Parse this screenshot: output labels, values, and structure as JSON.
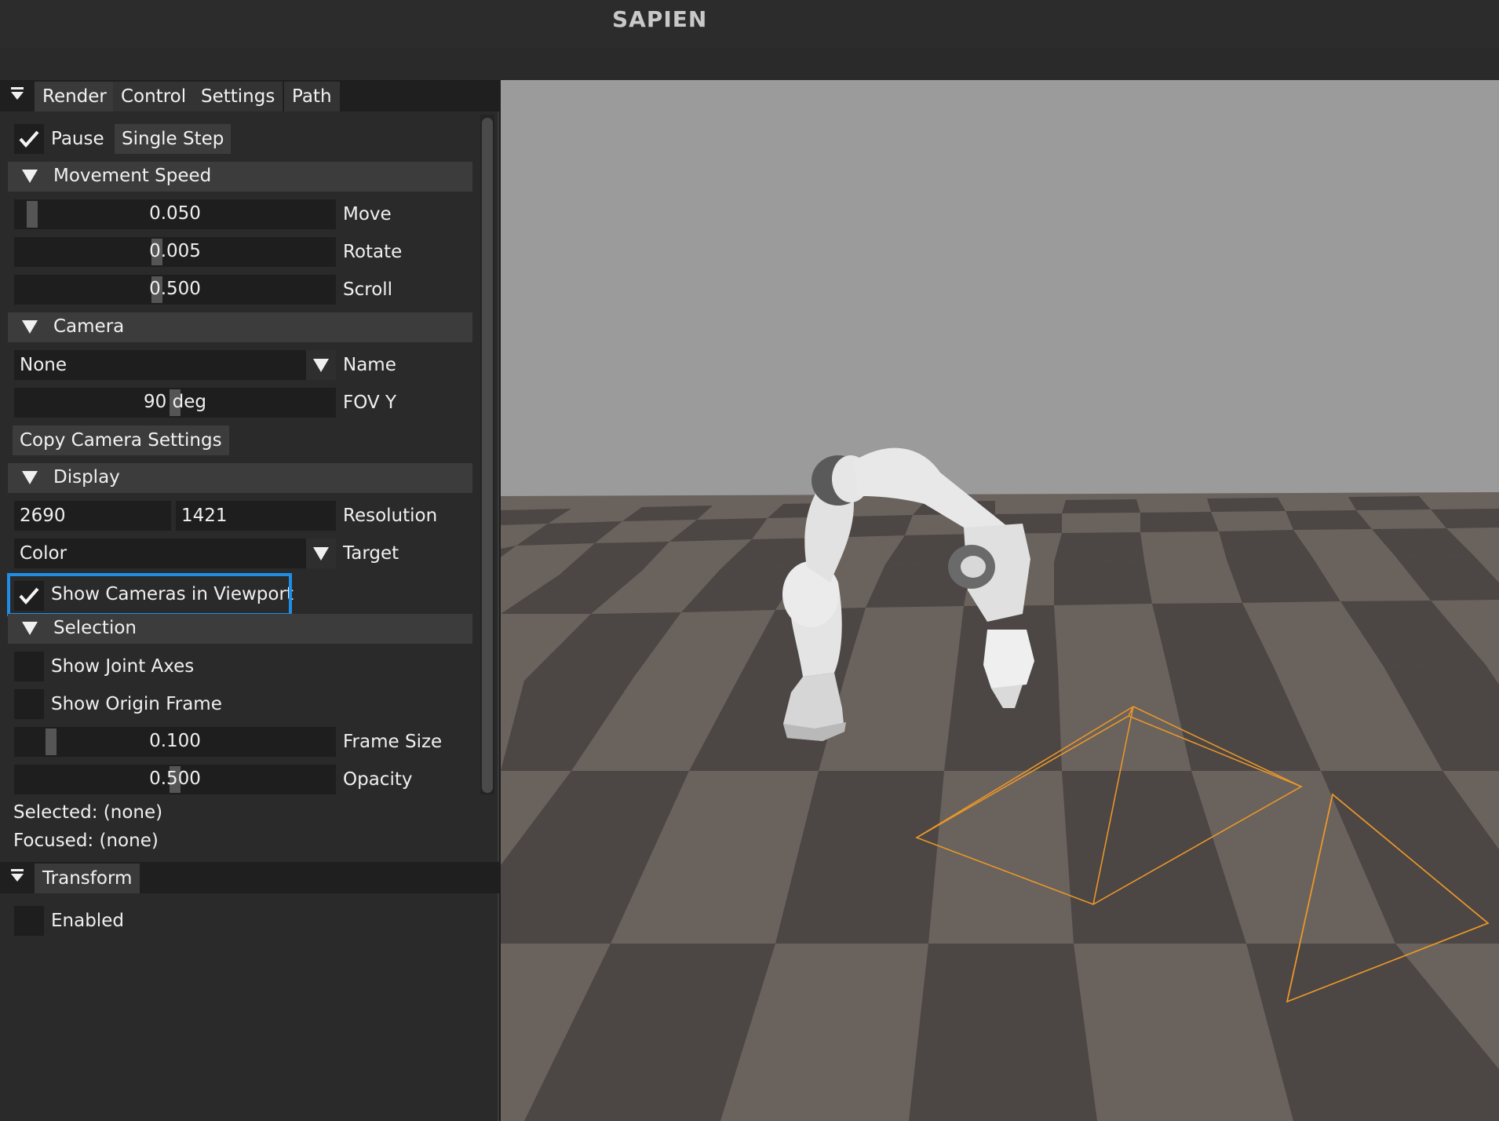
{
  "window": {
    "title": "SAPIEN"
  },
  "tabs": [
    {
      "label": "Render"
    },
    {
      "label": "Control"
    },
    {
      "label": "Settings"
    },
    {
      "label": "Path"
    }
  ],
  "control": {
    "pause_label": "Pause",
    "pause_checked": true,
    "single_step_label": "Single Step",
    "movement": {
      "header": "Movement Speed",
      "move": {
        "value": "0.050",
        "label": "Move",
        "fraction": 0.05
      },
      "rotate": {
        "value": "0.005",
        "label": "Rotate",
        "fraction": 0.45
      },
      "scroll": {
        "value": "0.500",
        "label": "Scroll",
        "fraction": 0.45
      }
    },
    "camera": {
      "header": "Camera",
      "name_value": "None",
      "name_label": "Name",
      "fov_value": "90 deg",
      "fov_label": "FOV Y",
      "copy_label": "Copy Camera Settings"
    },
    "display": {
      "header": "Display",
      "res_width": "2690",
      "res_height": "1421",
      "res_label": "Resolution",
      "target_value": "Color",
      "target_label": "Target",
      "show_cameras_label": "Show Cameras in Viewport",
      "show_cameras_checked": true
    },
    "selection": {
      "header": "Selection",
      "joint_axes_label": "Show Joint Axes",
      "origin_frame_label": "Show Origin Frame",
      "frame_size": {
        "value": "0.100",
        "label": "Frame Size",
        "fraction": 0.1
      },
      "opacity": {
        "value": "0.500",
        "label": "Opacity",
        "fraction": 0.5
      },
      "selected_text": "Selected: (none)",
      "focused_text": "Focused: (none)"
    }
  },
  "transform": {
    "tab_label": "Transform",
    "enabled_label": "Enabled",
    "enabled_checked": false
  },
  "colors": {
    "accent_highlight": "#1f8ee6",
    "camera_frustum": "#e8962a",
    "robot": "#e6e6e6"
  }
}
